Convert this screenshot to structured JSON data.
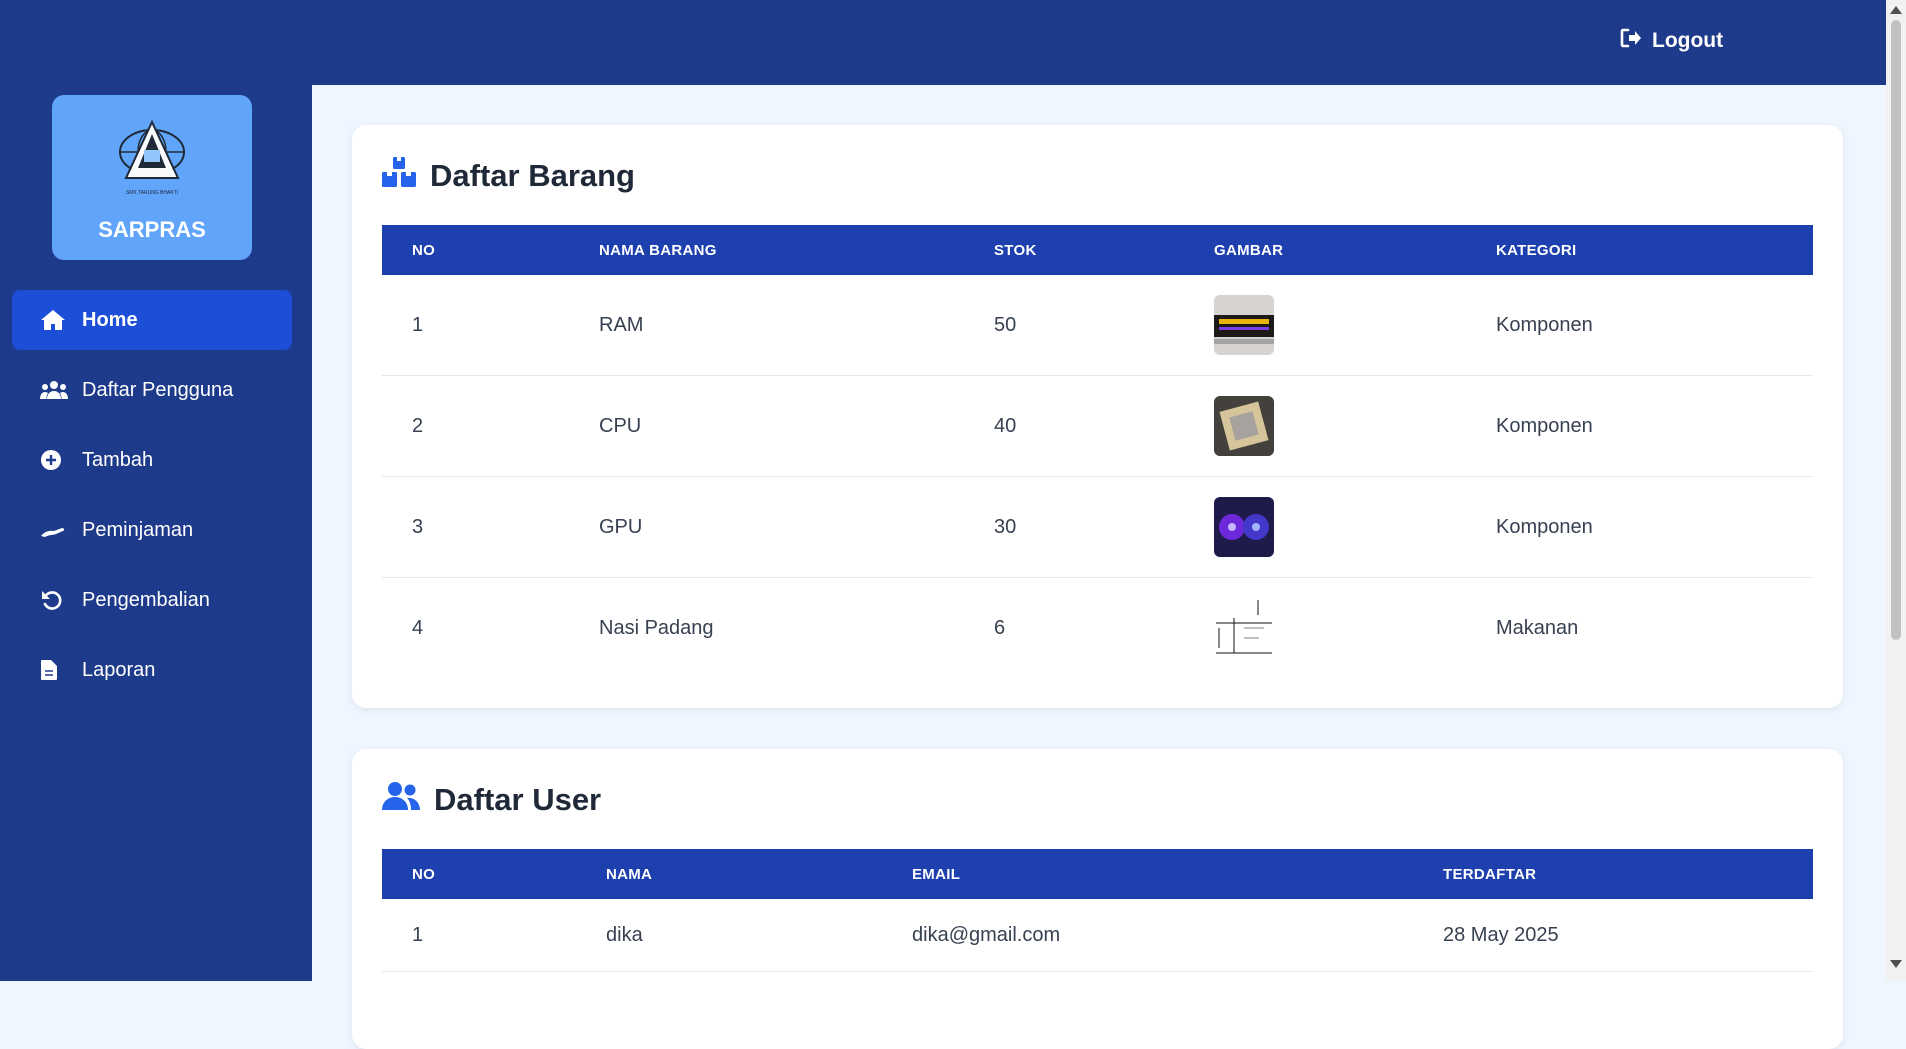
{
  "header": {
    "logout_label": "Logout"
  },
  "sidebar": {
    "brand_name": "SARPRAS",
    "logo_caption": "SMK TARUNG BHAKTI",
    "items": [
      {
        "label": "Home",
        "icon": "home-icon",
        "active": true
      },
      {
        "label": "Daftar Pengguna",
        "icon": "users-icon"
      },
      {
        "label": "Tambah",
        "icon": "plus-circle-icon"
      },
      {
        "label": "Peminjaman",
        "icon": "hand-icon"
      },
      {
        "label": "Pengembalian",
        "icon": "undo-icon"
      },
      {
        "label": "Laporan",
        "icon": "file-icon"
      }
    ]
  },
  "barang": {
    "title": "Daftar Barang",
    "icon": "boxes-icon",
    "columns": [
      "NO",
      "NAMA BARANG",
      "STOK",
      "GAMBAR",
      "KATEGORI"
    ],
    "rows": [
      {
        "no": "1",
        "nama": "RAM",
        "stok": "50",
        "gambar": "ram-image",
        "kategori": "Komponen"
      },
      {
        "no": "2",
        "nama": "CPU",
        "stok": "40",
        "gambar": "cpu-image",
        "kategori": "Komponen"
      },
      {
        "no": "3",
        "nama": "GPU",
        "stok": "30",
        "gambar": "gpu-image",
        "kategori": "Komponen"
      },
      {
        "no": "4",
        "nama": "Nasi Padang",
        "stok": "6",
        "gambar": "nasi-padang-image",
        "kategori": "Makanan"
      }
    ]
  },
  "users": {
    "title": "Daftar User",
    "icon": "users-icon",
    "columns": [
      "NO",
      "NAMA",
      "EMAIL",
      "TERDAFTAR"
    ],
    "rows": [
      {
        "no": "1",
        "nama": "dika",
        "email": "dika@gmail.com",
        "terdaftar": "28 May 2025"
      }
    ]
  }
}
